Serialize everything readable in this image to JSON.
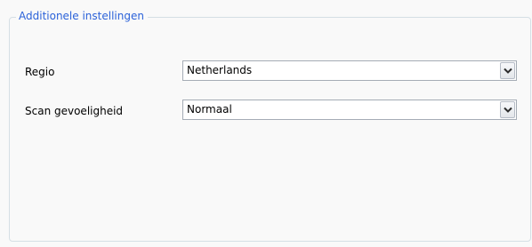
{
  "groupbox": {
    "title": "Additionele instellingen"
  },
  "fields": {
    "regio": {
      "label": "Regio",
      "value": "Netherlands"
    },
    "scan": {
      "label": "Scan gevoeligheid",
      "value": "Normaal"
    }
  },
  "icons": {
    "dropdown": "chevron-down-icon"
  }
}
